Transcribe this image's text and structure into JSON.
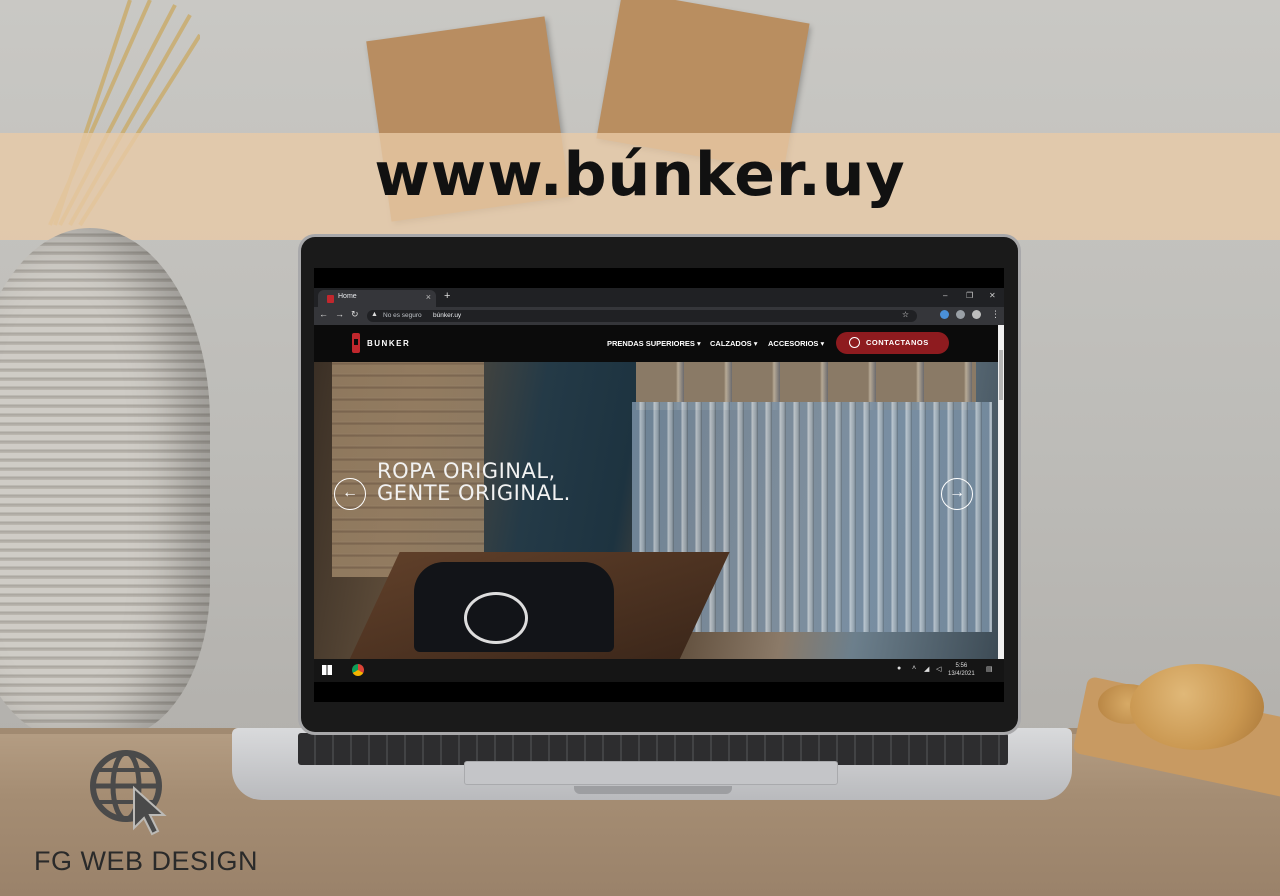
{
  "banner": {
    "url_title": "www.búnker.uy"
  },
  "browser": {
    "tab_title": "Home",
    "tab_close": "×",
    "new_tab": "+",
    "security_text": "No es seguro",
    "url": "búnker.uy",
    "window_controls": [
      "–",
      "❐",
      "✕"
    ]
  },
  "site": {
    "logo_text": "BUNKER",
    "menu": [
      "PRENDAS SUPERIORES ▾",
      "CALZADOS ▾",
      "ACCESORIOS ▾"
    ],
    "cta_label": "CONTACTANOS",
    "hero_line1": "ROPA ORIGINAL,",
    "hero_line2": "GENTE ORIGINAL.",
    "prev_arrow": "←",
    "next_arrow": "→"
  },
  "taskbar": {
    "time": "5:56",
    "date": "13/4/2021"
  },
  "watermark": {
    "text": "FG WEB DESIGN"
  },
  "colors": {
    "brand_red": "#c1272d",
    "cta_red": "#8e1b1f",
    "band": "#e9caa7"
  }
}
